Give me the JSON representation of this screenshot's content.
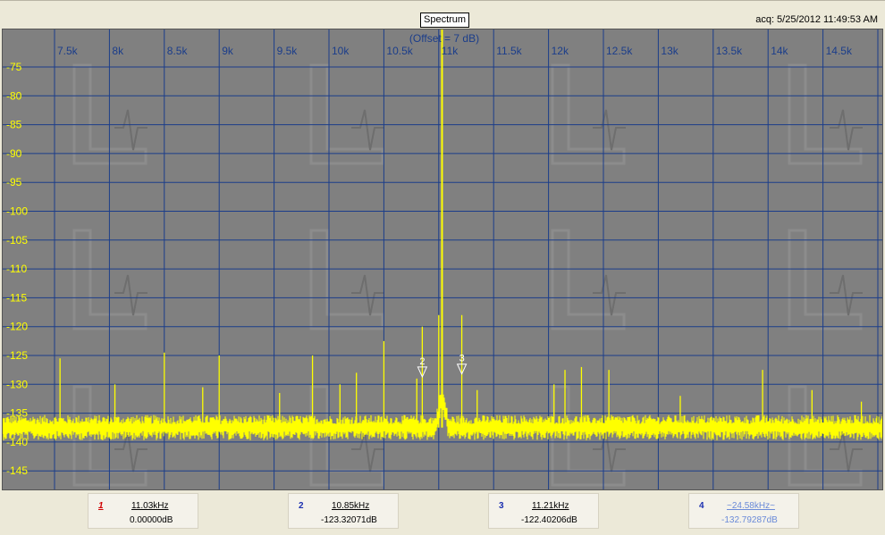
{
  "window": {
    "title": "Spectrum",
    "acq_label": "acq: 5/25/2012 11:49:53 AM"
  },
  "chart_data": {
    "type": "line",
    "subtitle": "(Offset = 7 dB)",
    "x_tick_labels": [
      "7.5k",
      "8k",
      "8.5k",
      "9k",
      "9.5k",
      "10k",
      "10.5k",
      "11k",
      "11.5k",
      "12k",
      "12.5k",
      "13k",
      "13.5k",
      "14k",
      "14.5k"
    ],
    "y_tick_labels": [
      "-75",
      "-80",
      "-85",
      "-90",
      "-95",
      "-100",
      "-105",
      "-110",
      "-115",
      "-120",
      "-125",
      "-130",
      "-135",
      "-140",
      "-145"
    ],
    "xlim": [
      7000,
      15000
    ],
    "ylim": [
      -149,
      -71
    ],
    "x_unit": "Hz",
    "y_unit": "dB",
    "noise_floor": -137.5,
    "series": [
      {
        "peaks": [
          {
            "x": 11030,
            "y": -58
          },
          {
            "x": 11000,
            "y": -118
          },
          {
            "x": 10850,
            "y": -120
          },
          {
            "x": 11210,
            "y": -118
          },
          {
            "x": 7550,
            "y": -125.5
          },
          {
            "x": 8050,
            "y": -130
          },
          {
            "x": 8500,
            "y": -124.5
          },
          {
            "x": 8850,
            "y": -130.5
          },
          {
            "x": 9000,
            "y": -125
          },
          {
            "x": 9550,
            "y": -131.5
          },
          {
            "x": 9850,
            "y": -125
          },
          {
            "x": 10100,
            "y": -130
          },
          {
            "x": 10250,
            "y": -128
          },
          {
            "x": 10500,
            "y": -122.5
          },
          {
            "x": 10800,
            "y": -129
          },
          {
            "x": 11350,
            "y": -131
          },
          {
            "x": 12050,
            "y": -130
          },
          {
            "x": 12150,
            "y": -127.5
          },
          {
            "x": 12300,
            "y": -127
          },
          {
            "x": 12550,
            "y": -127.5
          },
          {
            "x": 13200,
            "y": -132
          },
          {
            "x": 13950,
            "y": -127.5
          },
          {
            "x": 14400,
            "y": -131
          },
          {
            "x": 14850,
            "y": -133
          }
        ]
      }
    ],
    "colors": {
      "background": "#808080",
      "grid": "#1b3d8a",
      "trace": "#ffff00",
      "x_tick_color": "#1b3d8a",
      "y_tick_color": "#ffff00"
    },
    "plot_markers": [
      {
        "label": "2",
        "x": 10850,
        "y": -127
      },
      {
        "label": "3",
        "x": 11210,
        "y": -126.5
      }
    ]
  },
  "markers": [
    {
      "num": "1",
      "freq": "11.03kHz",
      "db": "0.00000dB"
    },
    {
      "num": "2",
      "freq": "10.85kHz",
      "db": "-123.32071dB"
    },
    {
      "num": "3",
      "freq": "11.21kHz",
      "db": "-122.40206dB"
    },
    {
      "num": "4",
      "freq": "~24.58kHz~",
      "db": "-132.79287dB"
    }
  ]
}
